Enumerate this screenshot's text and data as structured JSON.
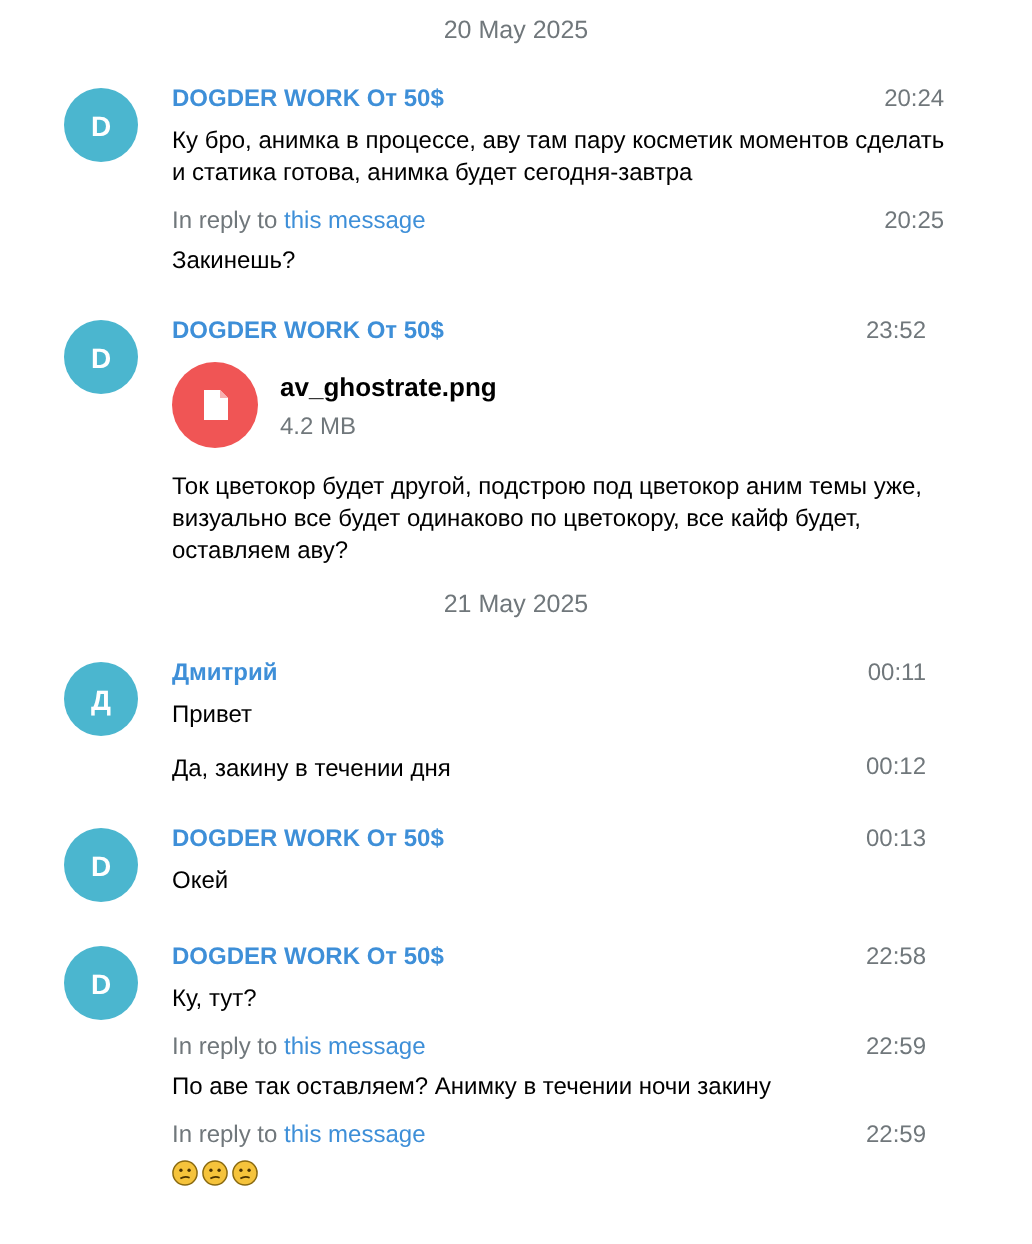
{
  "history": [
    {
      "kind": "date",
      "text": "20 May 2025"
    },
    {
      "kind": "group",
      "initial": "D",
      "name": "DOGDER WORK От 50$",
      "messages": [
        {
          "time": "20:24",
          "text": "Ку бро, анимка в процессе, аву там пару косметик моментов сделать\nи статика готова, анимка будет сегодня-завтра"
        },
        {
          "time": "20:25",
          "reply": {
            "prefix": "In reply to",
            "link": "this message"
          },
          "text": "Закинешь?"
        }
      ]
    },
    {
      "kind": "group",
      "initial": "D",
      "name": "DOGDER WORK От 50$",
      "messages": [
        {
          "time": "23:52",
          "file": {
            "name": "av_ghostrate.png",
            "size": "4.2 MB"
          },
          "text": "Ток цветокор будет другой, подстрою под цветокор аним темы уже,\nвизуально все будет одинаково по цветокору, все кайф будет,\nоставляем аву?"
        }
      ]
    },
    {
      "kind": "date",
      "text": "21 May 2025"
    },
    {
      "kind": "group",
      "initial": "Д",
      "name": "Дмитрий",
      "messages": [
        {
          "time": "00:11",
          "text": "Привет"
        },
        {
          "time": "00:12",
          "text": "Да, закину в течении дня"
        }
      ]
    },
    {
      "kind": "group",
      "initial": "D",
      "name": "DOGDER WORK От 50$",
      "messages": [
        {
          "time": "00:13",
          "text": "Окей"
        }
      ]
    },
    {
      "kind": "group",
      "initial": "D",
      "name": "DOGDER WORK От 50$",
      "messages": [
        {
          "time": "22:58",
          "text": "Ку, тут?"
        },
        {
          "time": "22:59",
          "reply": {
            "prefix": "In reply to",
            "link": "this message"
          },
          "text": "По аве так оставляем? Анимку в течении ночи закину"
        },
        {
          "time": "22:59",
          "reply": {
            "prefix": "In reply to",
            "link": "this message"
          },
          "emoji": [
            {
              "kind": "confused"
            },
            {
              "kind": "confused"
            },
            {
              "kind": "confused"
            }
          ]
        }
      ]
    }
  ]
}
